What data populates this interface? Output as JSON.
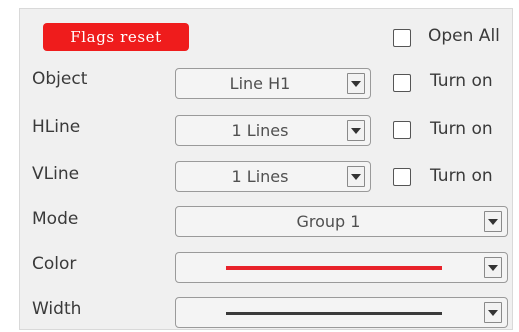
{
  "toolbar": {
    "flags_reset_label": "Flags reset"
  },
  "open_all": {
    "label": "Open All",
    "checked": false
  },
  "rows": {
    "object": {
      "label": "Object",
      "value": "Line H1",
      "toggle_label": "Turn on",
      "toggle_checked": false
    },
    "hline": {
      "label": "HLine",
      "value": "1 Lines",
      "toggle_label": "Turn on",
      "toggle_checked": false
    },
    "vline": {
      "label": "VLine",
      "value": "1 Lines",
      "toggle_label": "Turn on",
      "toggle_checked": false
    },
    "mode": {
      "label": "Mode",
      "value": "Group 1"
    },
    "color": {
      "label": "Color",
      "swatch": "#e8222a"
    },
    "width": {
      "label": "Width",
      "swatch": "#3a3a3a"
    }
  },
  "icons": {
    "dropdown": "dropdown-arrow-icon",
    "checkbox": "checkbox-icon"
  },
  "colors": {
    "accent": "#ef1c1c",
    "panel": "#f0f0f0"
  }
}
